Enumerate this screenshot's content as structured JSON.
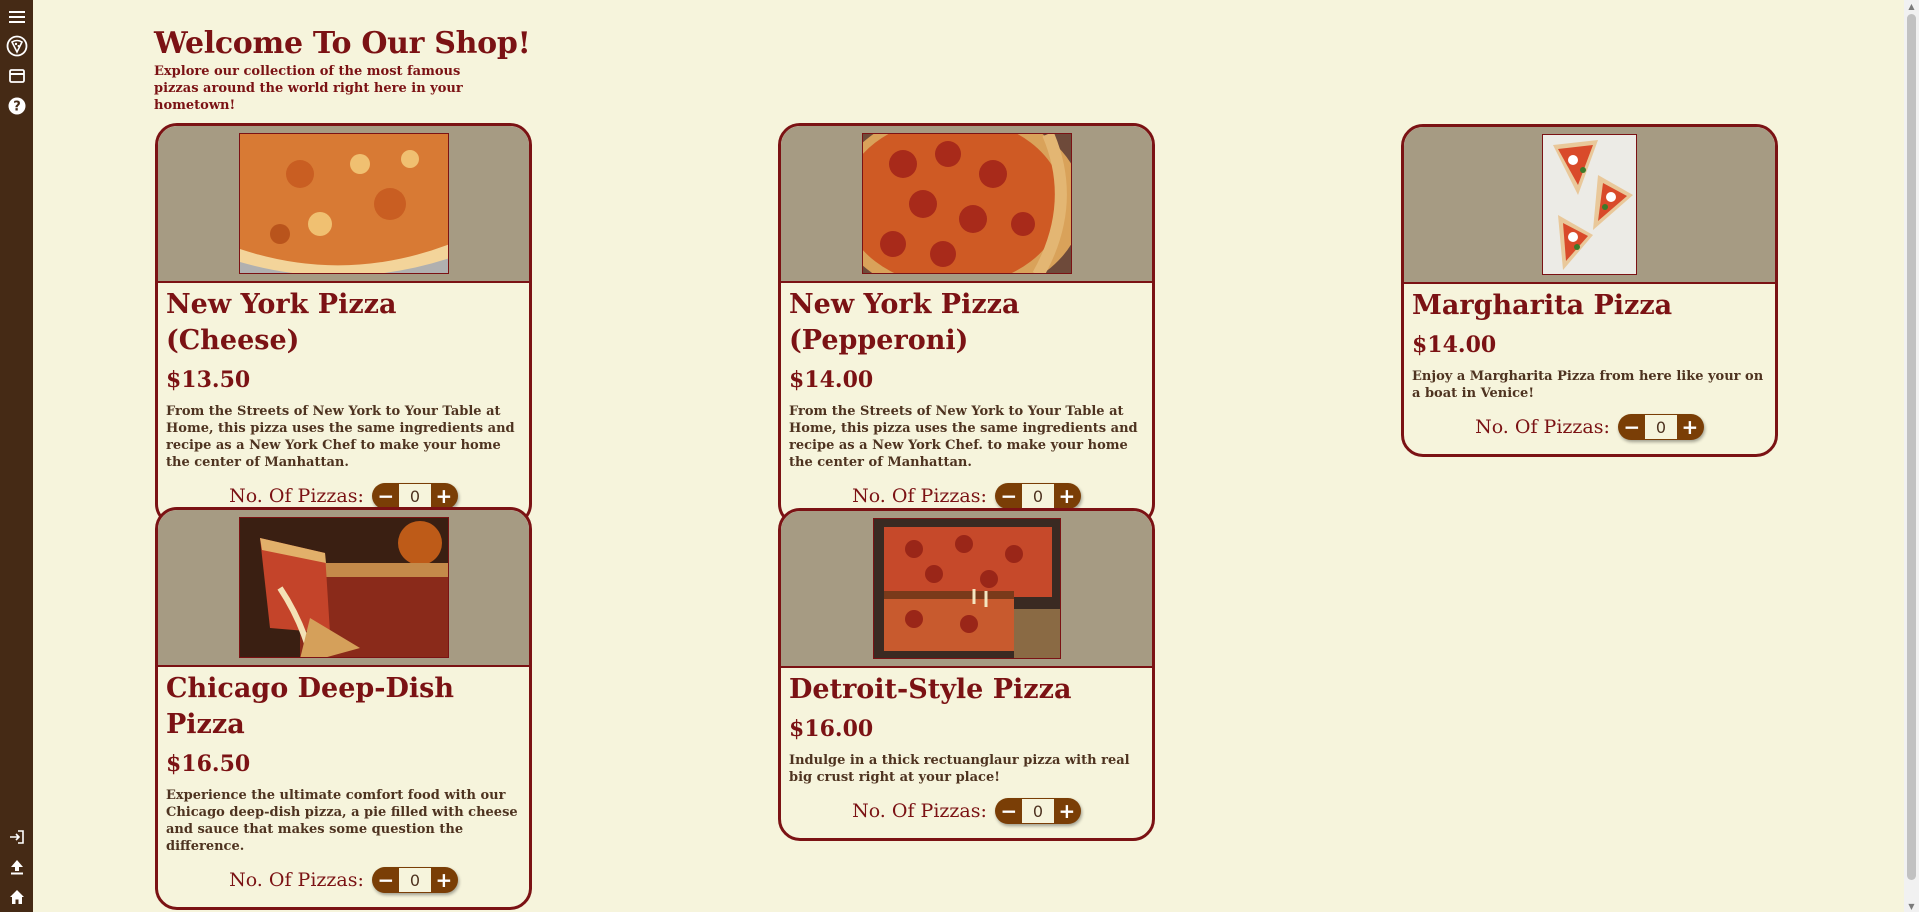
{
  "sidebar": {
    "top_icons": [
      "menu-icon",
      "pizza-icon",
      "card-icon",
      "help-icon"
    ],
    "bottom_icons": [
      "login-icon",
      "upload-icon",
      "home-icon"
    ]
  },
  "header": {
    "title": "Welcome To Our Shop!",
    "subtitle": "Explore our collection of the most famous pizzas around the world right here in your hometown!"
  },
  "qty_label": "No. Of Pizzas:",
  "pizzas": [
    {
      "name": "New York Pizza (Cheese)",
      "price": "$13.50",
      "description": "From the Streets of New York to Your Table at Home, this pizza uses the same ingredients and recipe as a New York Chef to make your home the center of Manhattan.",
      "quantity": "0"
    },
    {
      "name": "New York Pizza (Pepperoni)",
      "price": "$14.00",
      "description": "From the Streets of New York to Your Table at Home, this pizza uses the same ingredients and recipe as a New York Chef. to make your home the center of Manhattan.",
      "quantity": "0"
    },
    {
      "name": "Margharita Pizza",
      "price": "$14.00",
      "description": "Enjoy a Margharita Pizza from here like your on a boat in Venice!",
      "quantity": "0"
    },
    {
      "name": "Chicago Deep-Dish Pizza",
      "price": "$16.50",
      "description": "Experience the ultimate comfort food with our Chicago deep-dish pizza, a pie filled with cheese and sauce that makes some question the difference.",
      "quantity": "0"
    },
    {
      "name": "Detroit-Style Pizza",
      "price": "$16.00",
      "description": "Indulge in a thick rectuanglaur pizza with real big crust right at your place!",
      "quantity": "0"
    }
  ],
  "colors": {
    "background": "#f6f4dc",
    "sidebar": "#452a15",
    "accent": "#7b1214",
    "image_panel": "#a69b83",
    "stepper": "#7a3e06"
  }
}
